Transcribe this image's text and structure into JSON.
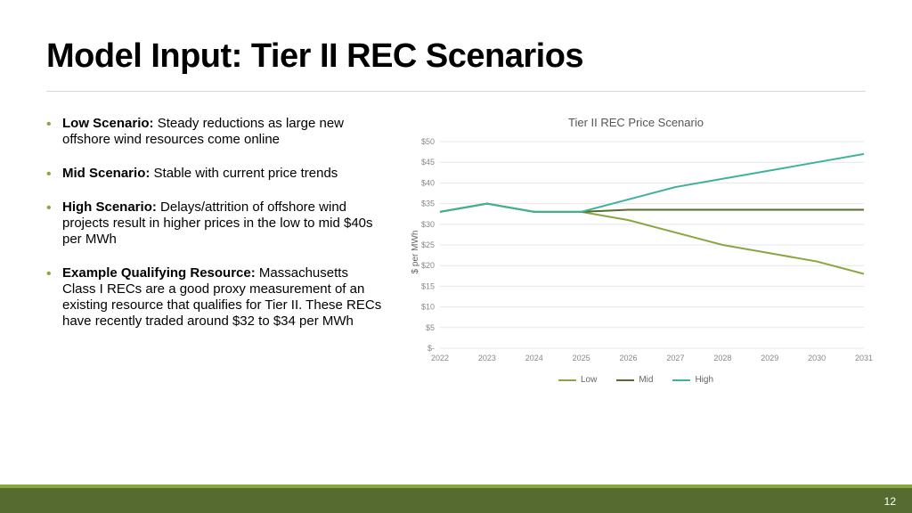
{
  "header": {
    "title": "Model Input: Tier II REC Scenarios"
  },
  "bullets": [
    {
      "label": "Low Scenario:",
      "text": " Steady reductions as large new offshore wind resources come online"
    },
    {
      "label": "Mid Scenario:",
      "text": " Stable with current price trends"
    },
    {
      "label": "High Scenario:",
      "text": " Delays/attrition of offshore wind projects result in higher prices in the low to mid $40s per MWh"
    },
    {
      "label": "Example Qualifying Resource:",
      "text": " Massachusetts Class I RECs are a good proxy measurement of an existing resource that qualifies for Tier II. These RECs have recently traded around $32 to $34 per MWh"
    }
  ],
  "chart_data": {
    "type": "line",
    "title": "Tier II REC Price Scenario",
    "xlabel": "",
    "ylabel": "$ per MWh",
    "categories": [
      "2022",
      "2023",
      "2024",
      "2025",
      "2026",
      "2027",
      "2028",
      "2029",
      "2030",
      "2031"
    ],
    "y_ticks": [
      "$-",
      "$5",
      "$10",
      "$15",
      "$20",
      "$25",
      "$30",
      "$35",
      "$40",
      "$45",
      "$50"
    ],
    "ylim": [
      0,
      50
    ],
    "series": [
      {
        "name": "Low",
        "color": "#8aa63f",
        "values": [
          33,
          35,
          33,
          33,
          31,
          28,
          25,
          23,
          21,
          18
        ]
      },
      {
        "name": "Mid",
        "color": "#556b2f",
        "values": [
          33,
          35,
          33,
          33,
          33.5,
          33.5,
          33.5,
          33.5,
          33.5,
          33.5
        ]
      },
      {
        "name": "High",
        "color": "#3fb29b",
        "values": [
          33,
          35,
          33,
          33,
          36,
          39,
          41,
          43,
          45,
          47
        ]
      }
    ],
    "legend_position": "bottom"
  },
  "footer": {
    "page": "12"
  }
}
